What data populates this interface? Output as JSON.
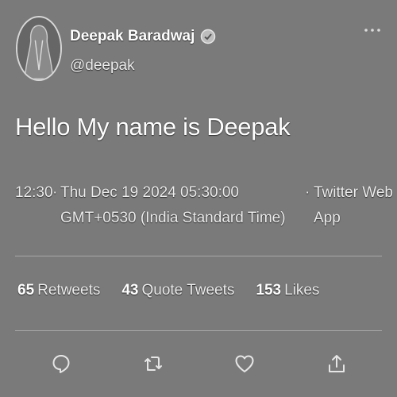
{
  "author": {
    "display_name": "Deepak Baradwaj",
    "handle": "@deepak"
  },
  "tweet": {
    "text": "Hello My name is Deepak"
  },
  "meta": {
    "time": "12:30",
    "separator": "·",
    "date": "Thu Dec 19 2024 05:30:00 GMT+0530 (India Standard Time)",
    "source": "Twitter Web App"
  },
  "stats": {
    "retweets": {
      "count": "65",
      "label": "Retweets"
    },
    "quotes": {
      "count": "43",
      "label": "Quote Tweets"
    },
    "likes": {
      "count": "153",
      "label": "Likes"
    }
  },
  "icons": {
    "verified": "verified-badge-icon",
    "more": "more-options-icon",
    "reply": "reply-icon",
    "retweet": "retweet-icon",
    "like": "heart-icon",
    "share": "share-icon"
  },
  "colors": {
    "background": "#777777",
    "text": "#ffffff",
    "divider": "#a8a8a8"
  }
}
